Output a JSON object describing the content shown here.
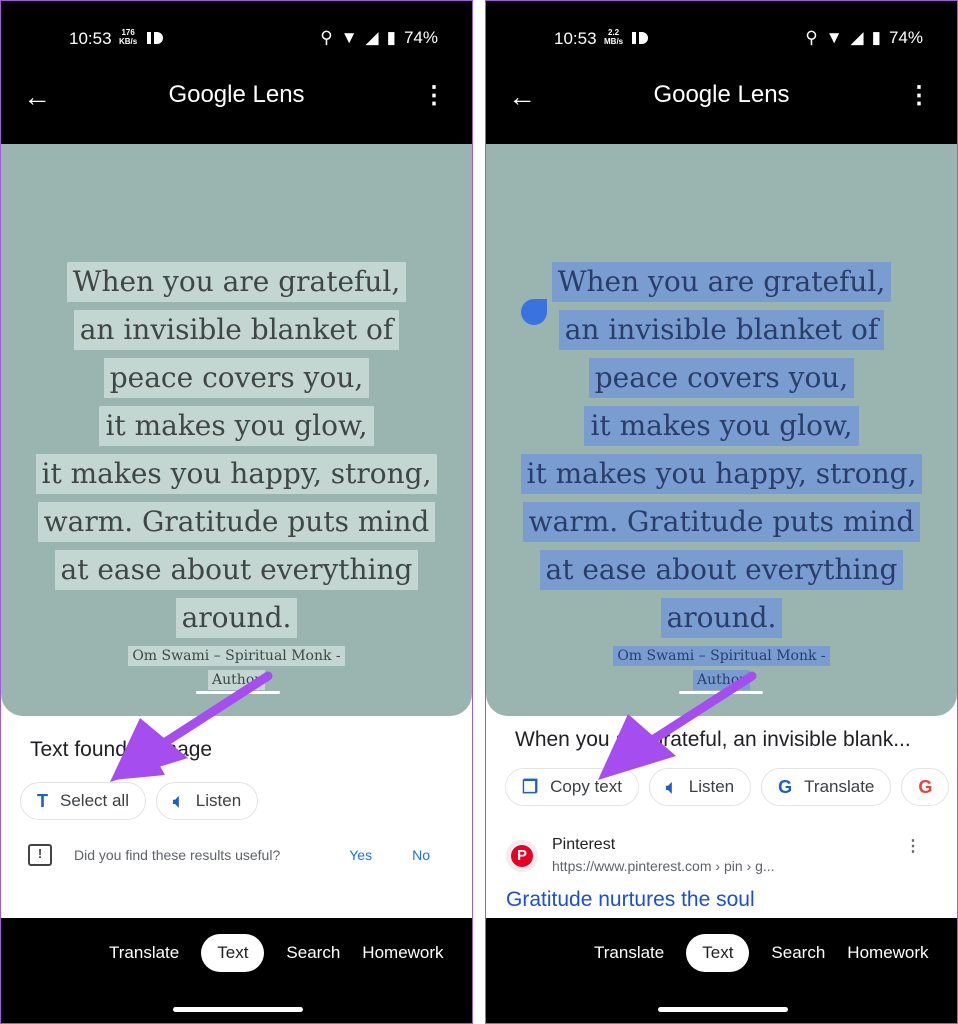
{
  "status": {
    "time": "10:53",
    "battery": "74%"
  },
  "left": {
    "speed": "176",
    "speed_unit": "KB/s"
  },
  "right": {
    "speed": "2.2",
    "speed_unit": "MB/s"
  },
  "header": {
    "title": "Google Lens",
    "back_icon": "arrow-left-icon",
    "menu_icon": "more-vert-icon"
  },
  "quote": {
    "lines": [
      "When you are grateful,",
      "an invisible blanket of",
      "peace covers you,",
      "it makes you glow,",
      "it makes you happy, strong,",
      "warm. Gratitude puts mind",
      "at ease about everything",
      "around."
    ],
    "attribution": [
      "Om Swami – Spiritual Monk -",
      "Author"
    ]
  },
  "left_sheet": {
    "heading": "Text found in image",
    "chips": [
      "Select all",
      "Listen"
    ],
    "feedback": {
      "question": "Did you find these results useful?",
      "yes": "Yes",
      "no": "No"
    }
  },
  "right_sheet": {
    "heading": "When you are grateful, an invisible blank...",
    "chips": [
      "Copy text",
      "Listen",
      "Translate"
    ],
    "result": {
      "source": "Pinterest",
      "url": "https://www.pinterest.com › pin › g...",
      "title": "Gratitude nurtures the soul"
    }
  },
  "nav": {
    "tabs": [
      "Translate",
      "Text",
      "Search",
      "Homework"
    ],
    "active": "Text"
  },
  "colors": {
    "accent": "#1a73e8",
    "arrow": "#a64df0",
    "image_bg": "#9ab5b0",
    "selection": "#6e96dc"
  }
}
